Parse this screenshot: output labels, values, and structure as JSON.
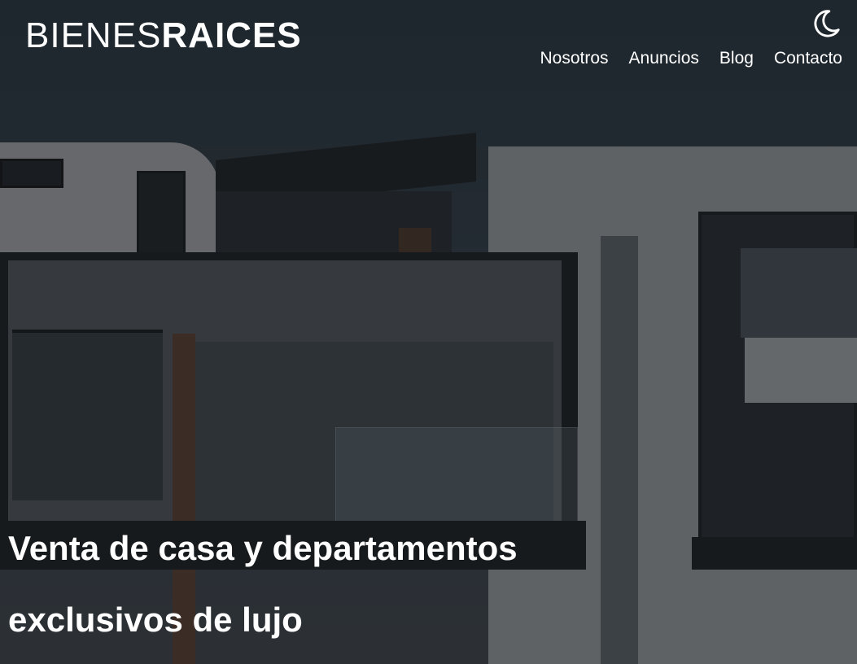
{
  "header": {
    "logo_thin": "BIENES",
    "logo_bold": "RAICES",
    "theme_toggle_icon": "moon-icon"
  },
  "nav": {
    "items": [
      {
        "label": "Nosotros"
      },
      {
        "label": "Anuncios"
      },
      {
        "label": "Blog"
      },
      {
        "label": "Contacto"
      }
    ]
  },
  "hero": {
    "title_line1": "Venta de casa y departamentos",
    "title_line2": "exclusivos de lujo"
  },
  "colors": {
    "text": "#ffffff",
    "overlay": "#14181c"
  }
}
